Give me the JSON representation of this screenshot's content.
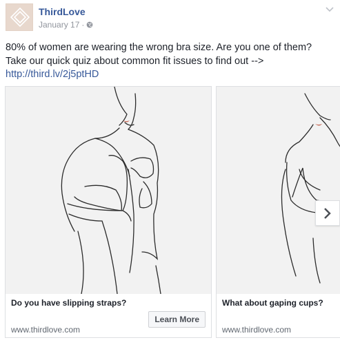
{
  "post": {
    "page_name": "ThirdLove",
    "date": "January 17",
    "separator": "·",
    "text": "80% of women are wearing the wrong bra size. Are you one of them? Take our quick quiz about common fit issues to find out -->",
    "link": "http://third.lv/2j5ptHD"
  },
  "carousel": {
    "cards": [
      {
        "title": "Do you have slipping straps?",
        "url": "www.thirdlove.com",
        "cta": "Learn More"
      },
      {
        "title": "What about gaping cups?",
        "url": "www.thirdlove.com"
      }
    ]
  },
  "icons": {
    "avatar": "thirdlove-logo-icon",
    "privacy": "globe-icon",
    "menu": "chevron-down-icon",
    "next": "chevron-right-icon"
  },
  "colors": {
    "link": "#365899",
    "meta": "#90949c",
    "avatar_bg": "#e8d8cd"
  }
}
